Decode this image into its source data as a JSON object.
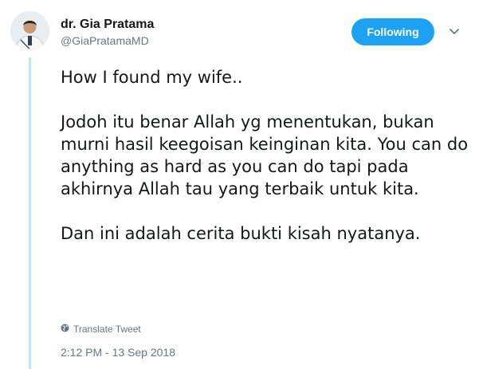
{
  "author": {
    "name": "dr. Gia Pratama",
    "handle": "@GiaPratamaMD"
  },
  "follow_button": {
    "label": "Following",
    "color": "#1da1f2"
  },
  "menu": {
    "icon": "chevron-down-icon"
  },
  "tweet": {
    "paragraphs": [
      "How I found my wife..",
      "Jodoh itu benar Allah yg menentukan, bukan murni hasil keegoisan keinginan kita. You can do anything as hard as you can do tapi pada akhirnya Allah tau yang terbaik untuk kita.",
      "Dan ini adalah cerita bukti kisah nyatanya."
    ]
  },
  "translate": {
    "label": "Translate Tweet",
    "icon": "globe-icon"
  },
  "timestamp": "2:12 PM - 13 Sep 2018",
  "colors": {
    "thread_line": "#c4e5f6",
    "secondary_text": "#657786"
  }
}
